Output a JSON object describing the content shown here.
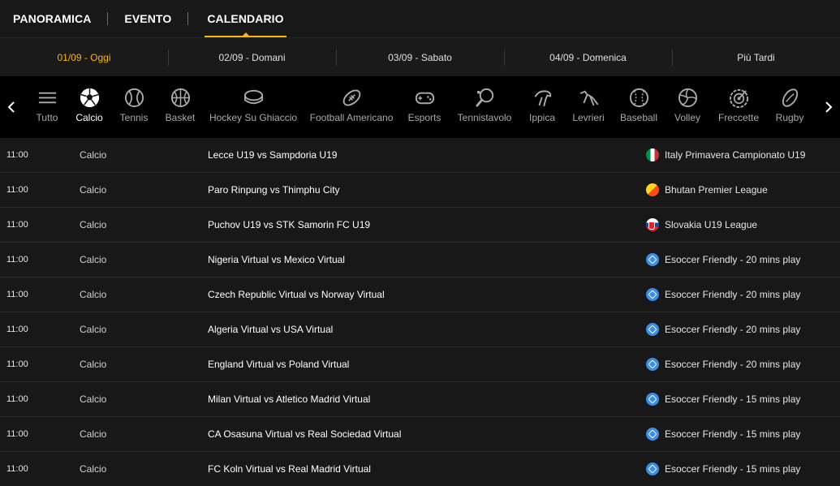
{
  "top_tabs": [
    {
      "label": "PANORAMICA"
    },
    {
      "label": "EVENTO"
    },
    {
      "label": "CALENDARIO"
    }
  ],
  "active_tab": "CALENDARIO",
  "dates": [
    {
      "label": "01/09 - Oggi"
    },
    {
      "label": "02/09 - Domani"
    },
    {
      "label": "03/09 - Sabato"
    },
    {
      "label": "04/09 - Domenica"
    },
    {
      "label": "Più Tardi"
    }
  ],
  "sports": [
    {
      "label": "Tutto",
      "icon": "menu-icon"
    },
    {
      "label": "Calcio",
      "icon": "soccer-ball-icon"
    },
    {
      "label": "Tennis",
      "icon": "tennis-ball-icon"
    },
    {
      "label": "Basket",
      "icon": "basketball-icon"
    },
    {
      "label": "Hockey Su Ghiaccio",
      "icon": "hockey-puck-icon"
    },
    {
      "label": "Football Americano",
      "icon": "american-football-icon"
    },
    {
      "label": "Esports",
      "icon": "gamepad-icon"
    },
    {
      "label": "Tennistavolo",
      "icon": "ping-pong-paddle-icon"
    },
    {
      "label": "Ippica",
      "icon": "horse-racing-icon"
    },
    {
      "label": "Levrieri",
      "icon": "greyhound-icon"
    },
    {
      "label": "Baseball",
      "icon": "baseball-icon"
    },
    {
      "label": "Volley",
      "icon": "volleyball-icon"
    },
    {
      "label": "Freccette",
      "icon": "dartboard-icon"
    },
    {
      "label": "Rugby",
      "icon": "rugby-ball-icon"
    }
  ],
  "active_sport": "Calcio",
  "events": [
    {
      "time": "11:00",
      "sport": "Calcio",
      "match": "Lecce U19 vs Sampdoria U19",
      "league": "Italy Primavera Campionato U19",
      "flag": "italy-flag-icon"
    },
    {
      "time": "11:00",
      "sport": "Calcio",
      "match": "Paro Rinpung vs Thimphu City",
      "league": "Bhutan Premier League",
      "flag": "bhutan-flag-icon"
    },
    {
      "time": "11:00",
      "sport": "Calcio",
      "match": "Puchov U19 vs STK Samorin FC U19",
      "league": "Slovakia U19 League",
      "flag": "slovakia-flag-icon"
    },
    {
      "time": "11:00",
      "sport": "Calcio",
      "match": "Nigeria Virtual vs Mexico Virtual",
      "league": "Esoccer Friendly - 20 mins play",
      "flag": "esoccer-icon"
    },
    {
      "time": "11:00",
      "sport": "Calcio",
      "match": "Czech Republic Virtual vs Norway Virtual",
      "league": "Esoccer Friendly - 20 mins play",
      "flag": "esoccer-icon"
    },
    {
      "time": "11:00",
      "sport": "Calcio",
      "match": "Algeria Virtual vs USA Virtual",
      "league": "Esoccer Friendly - 20 mins play",
      "flag": "esoccer-icon"
    },
    {
      "time": "11:00",
      "sport": "Calcio",
      "match": "England Virtual vs Poland Virtual",
      "league": "Esoccer Friendly - 20 mins play",
      "flag": "esoccer-icon"
    },
    {
      "time": "11:00",
      "sport": "Calcio",
      "match": "Milan Virtual vs Atletico Madrid Virtual",
      "league": "Esoccer Friendly - 15 mins play",
      "flag": "esoccer-icon"
    },
    {
      "time": "11:00",
      "sport": "Calcio",
      "match": "CA Osasuna Virtual vs Real Sociedad Virtual",
      "league": "Esoccer Friendly - 15 mins play",
      "flag": "esoccer-icon"
    },
    {
      "time": "11:00",
      "sport": "Calcio",
      "match": "FC Koln Virtual vs Real Madrid Virtual",
      "league": "Esoccer Friendly - 15 mins play",
      "flag": "esoccer-icon"
    }
  ],
  "colors": {
    "accent": "#f5b70b",
    "background": "#181818",
    "sports_bar": "#000000",
    "row_border": "#2c2c2c"
  }
}
